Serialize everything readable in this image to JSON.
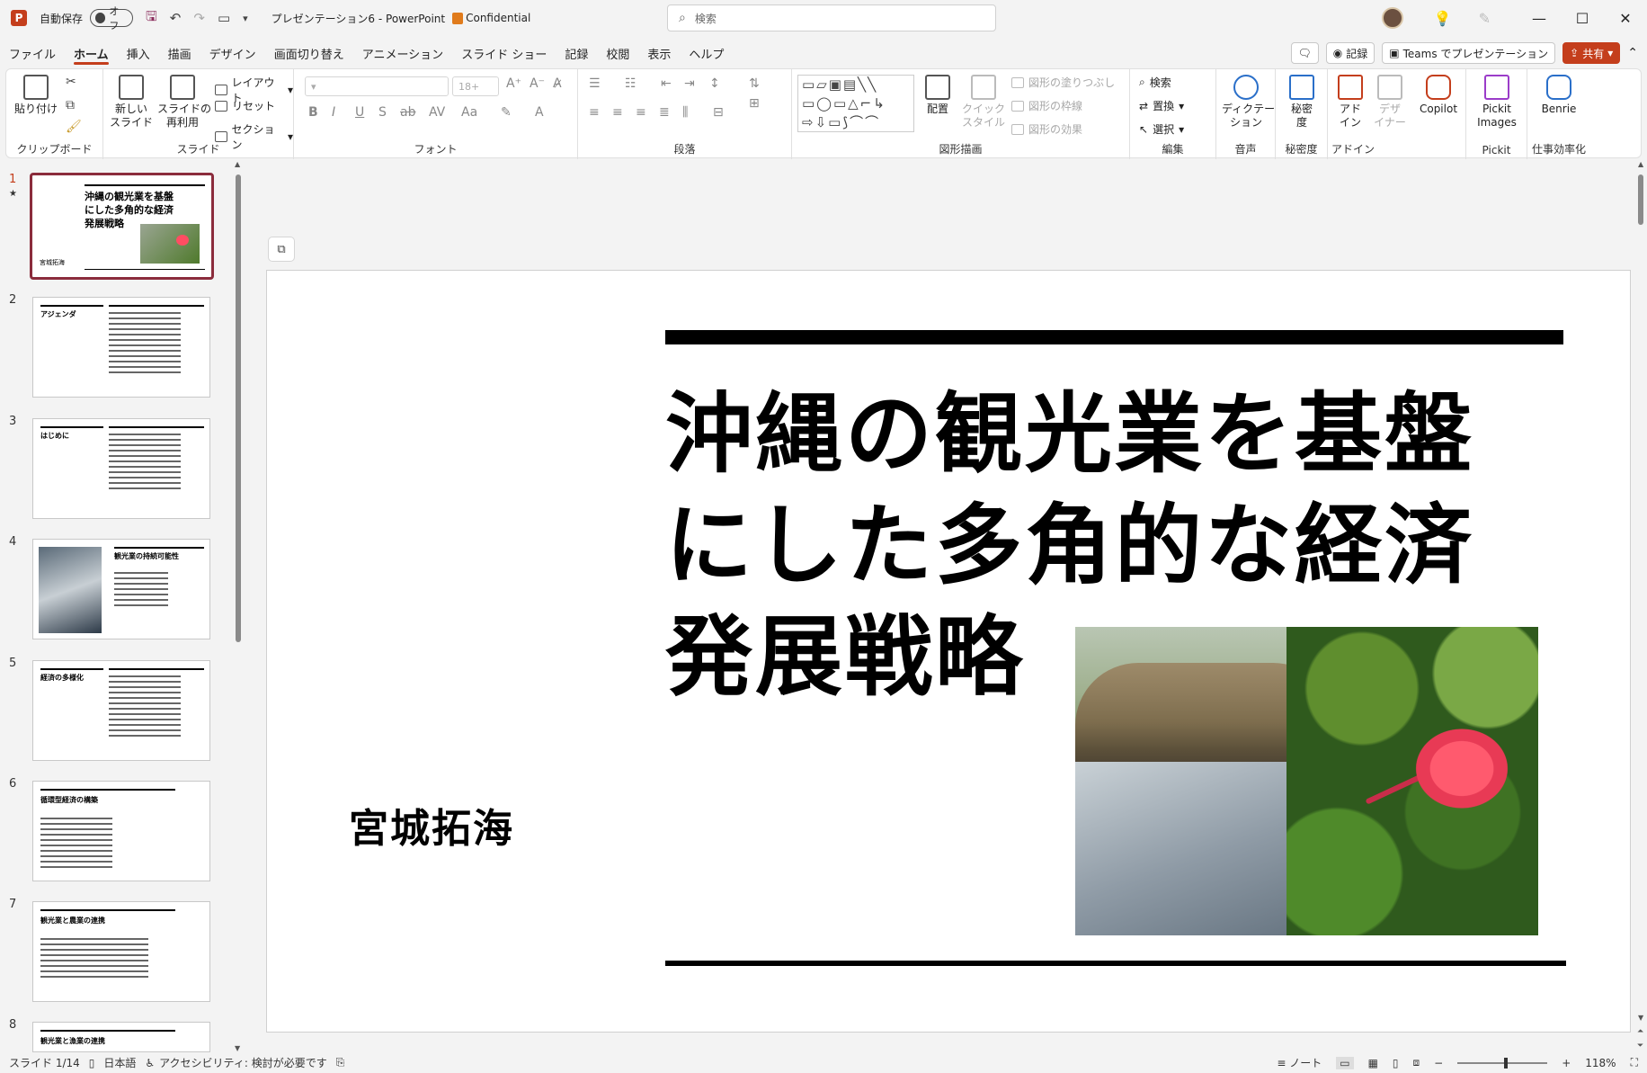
{
  "app": {
    "logo": "P",
    "autosave_label": "自動保存",
    "autosave_state": "オフ",
    "doc_title": "プレゼンテーション6 - PowerPoint",
    "sensitivity": "Confidential",
    "search_placeholder": "検索",
    "accent_color": "#c43e1c"
  },
  "tabs": [
    "ファイル",
    "ホーム",
    "挿入",
    "描画",
    "デザイン",
    "画面切り替え",
    "アニメーション",
    "スライド ショー",
    "記録",
    "校閲",
    "表示",
    "ヘルプ"
  ],
  "tabs_right": {
    "record": "記録",
    "teams": "Teams でプレゼンテーション",
    "share": "共有"
  },
  "ribbon": {
    "clipboard": {
      "paste": "貼り付け",
      "label": "クリップボード"
    },
    "slides": {
      "new_slide": "新しい\nスライド",
      "reuse": "スライドの\n再利用",
      "layout": "レイアウト",
      "reset": "リセット",
      "section": "セクション",
      "label": "スライド"
    },
    "font": {
      "font_size": "18+",
      "label": "フォント"
    },
    "paragraph": {
      "label": "段落"
    },
    "drawing": {
      "arrange": "配置",
      "quick_styles": "クイック\nスタイル",
      "fill": "図形の塗りつぶし",
      "outline": "図形の枠線",
      "effects": "図形の効果",
      "label": "図形描画"
    },
    "editing": {
      "find": "検索",
      "replace": "置換",
      "select": "選択",
      "label": "編集"
    },
    "voice": {
      "dictate": "ディクテー\nション",
      "label": "音声"
    },
    "sensitivity": {
      "btn": "秘密\n度",
      "label": "秘密度"
    },
    "addins": {
      "btn": "アド\nイン",
      "label": "アドイン"
    },
    "designer": {
      "btn": "デザ\nイナー"
    },
    "copilot": {
      "btn": "Copilot"
    },
    "pickit": {
      "btn": "Pickit\nImages",
      "label": "Pickit"
    },
    "benrie": {
      "btn": "Benrie",
      "label": "仕事効率化"
    }
  },
  "thumbnails": [
    {
      "num": "1",
      "title": "沖縄の観光業を基盤\nにした多角的な経済\n発展戦略",
      "author": "宮城拓海"
    },
    {
      "num": "2",
      "title": "アジェンダ"
    },
    {
      "num": "3",
      "title": "はじめに"
    },
    {
      "num": "4",
      "title": "観光業の持続可能性"
    },
    {
      "num": "5",
      "title": "経済の多様化"
    },
    {
      "num": "6",
      "title": "循環型経済の構築"
    },
    {
      "num": "7",
      "title": "観光業と農業の連携"
    },
    {
      "num": "8",
      "title": "観光業と漁業の連携"
    }
  ],
  "slide": {
    "title": "沖縄の観光業を基盤\nにした多角的な経済\n発展戦略",
    "author": "宮城拓海"
  },
  "status": {
    "slide_count": "スライド 1/14",
    "language": "日本語",
    "accessibility": "アクセシビリティ: 検討が必要です",
    "notes": "ノート",
    "zoom": "118%"
  }
}
